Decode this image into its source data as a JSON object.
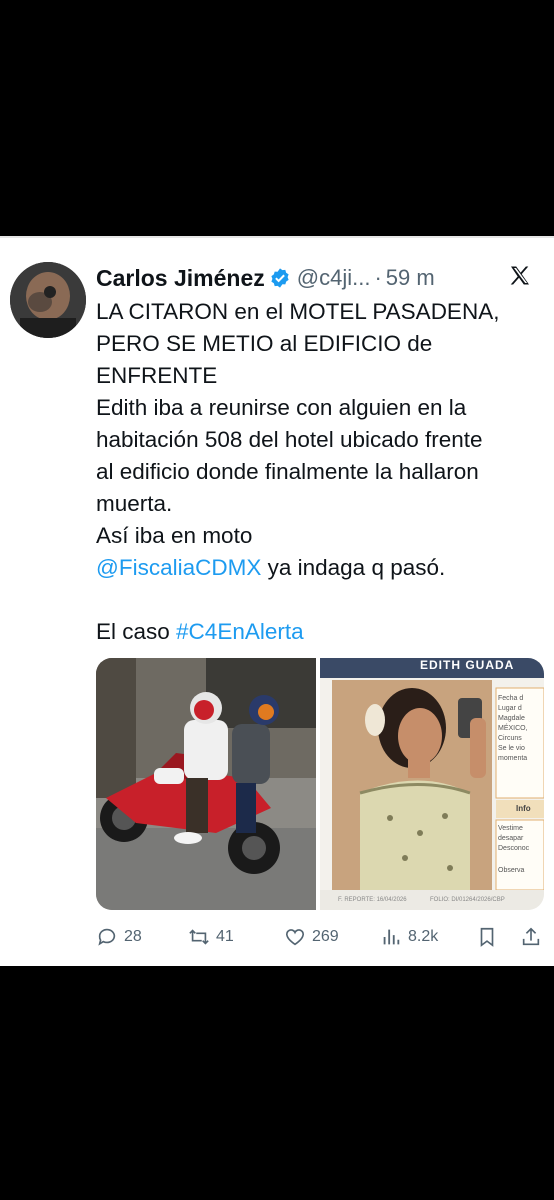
{
  "tweet": {
    "author_name": "Carlos Jiménez",
    "handle": "@c4ji...",
    "separator": "·",
    "time": "59 m",
    "lines": [
      "LA CITARON en el MOTEL PASADENA,",
      "PERO SE METIO al EDIFICIO de",
      "ENFRENTE",
      "Edith iba a reunirse con alguien en la",
      "habitación 508 del hotel ubicado frente",
      "al edificio donde finalmente la hallaron",
      "muerta.",
      "Así iba en moto"
    ],
    "mention": "@FiscaliaCDMX",
    "mention_rest": " ya indaga q pasó.",
    "caso_text": "El caso ",
    "hashtag": "#C4EnAlerta"
  },
  "media": {
    "poster_header": "EDITH GUADA",
    "poster_side_labels": [
      "Fecha d",
      "Lugar d",
      "Magdale",
      "MÉXICO,",
      "Circuns",
      "Se le vio",
      "momenta",
      "Info",
      "Vestime",
      "desapar",
      "Desconoc",
      "Observa"
    ],
    "poster_footer_left": "F. REPORTE: 16/04/2026",
    "poster_footer_right": "FOLIO: DI/01264/2026/CBP"
  },
  "actions": {
    "replies": "28",
    "retweets": "41",
    "likes": "269",
    "views": "8.2k"
  },
  "colors": {
    "link": "#1d9bf0",
    "verified": "#1d9bf0",
    "text": "#0f1419",
    "muted": "#536471"
  }
}
